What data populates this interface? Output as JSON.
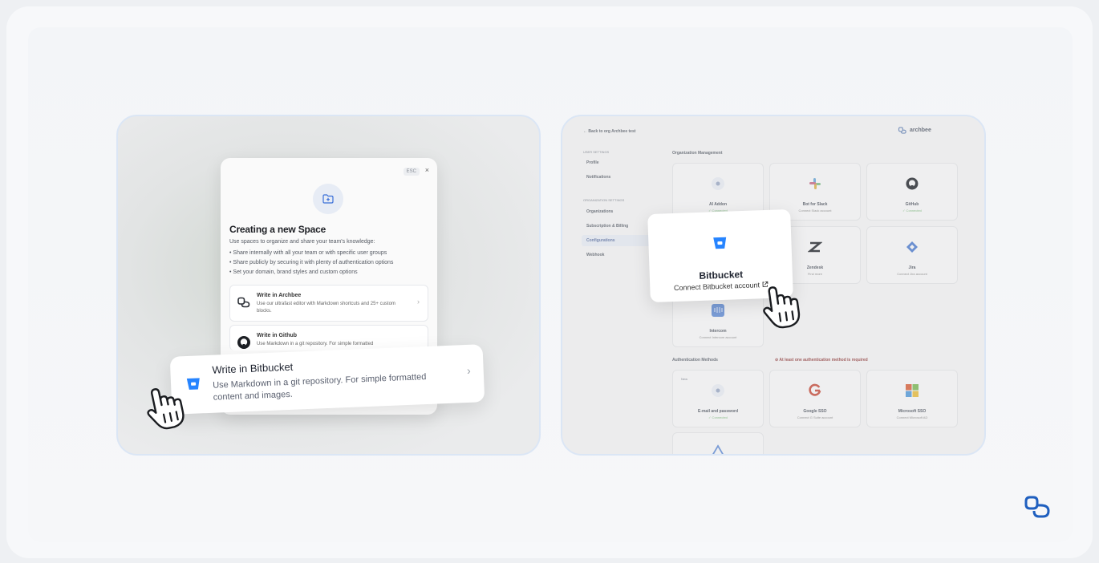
{
  "left_panel": {
    "modal": {
      "esc_label": "ESC",
      "close_label": "×",
      "title": "Creating a new Space",
      "intro": "Use spaces to organize and share your team's knowledge:",
      "bullets": [
        "Share internally with all your team or with specific user groups",
        "Share publicly by securing it with plenty of authentication options",
        "Set your domain, brand styles and custom options"
      ],
      "options": [
        {
          "title": "Write in Archbee",
          "desc": "Use our ultrafast editor with Markdown shortcuts and 25+ custom blocks."
        },
        {
          "title": "Write in Github",
          "desc": "Use Markdown in a git repository. For simple formatted"
        }
      ]
    },
    "bitbucket_option": {
      "title": "Write in Bitbucket",
      "desc": "Use Markdown in a git repository. For simple formatted content and images."
    }
  },
  "right_panel": {
    "back_link": "← Back to org Archbee test",
    "brand": "archbee",
    "sidebar": {
      "user_settings_header": "USER SETTINGS",
      "user_items": [
        "Profile",
        "Notifications"
      ],
      "org_settings_header": "ORGANIZATION SETTINGS",
      "org_items": [
        "Organizations",
        "Subscription & Billing",
        "Configurations",
        "Webhook"
      ]
    },
    "section_org_mgmt": "Organization Management",
    "integrations": [
      {
        "name": "AI Addon",
        "sub": "✓ Connected"
      },
      {
        "name": "Bot for Slack",
        "sub": "Connect Slack account"
      },
      {
        "name": "GitHub",
        "sub": "✓ Connected"
      },
      {
        "name": "Zendesk",
        "sub": "Find more"
      },
      {
        "name": "Jira",
        "sub": "Connect Jira account"
      },
      {
        "name": "Intercom",
        "sub": "Connect Intercom account"
      }
    ],
    "section_auth": "Authentication Methods",
    "auth_warning": "At least one authentication method is required",
    "auth_methods": [
      {
        "name": "E-mail and password",
        "sub": "✓ Connected",
        "badge": "New"
      },
      {
        "name": "Google SSO",
        "sub": "Connect G Suite account"
      },
      {
        "name": "Microsoft SSO",
        "sub": "Connect Microsoft AD"
      }
    ],
    "bitbucket_popup": {
      "title": "Bitbucket",
      "link": "Connect Bitbucket account"
    }
  },
  "colors": {
    "bitbucket_blue": "#2684ff",
    "brand_blue": "#1f5fbf",
    "panel_border": "#dbe6f5"
  }
}
